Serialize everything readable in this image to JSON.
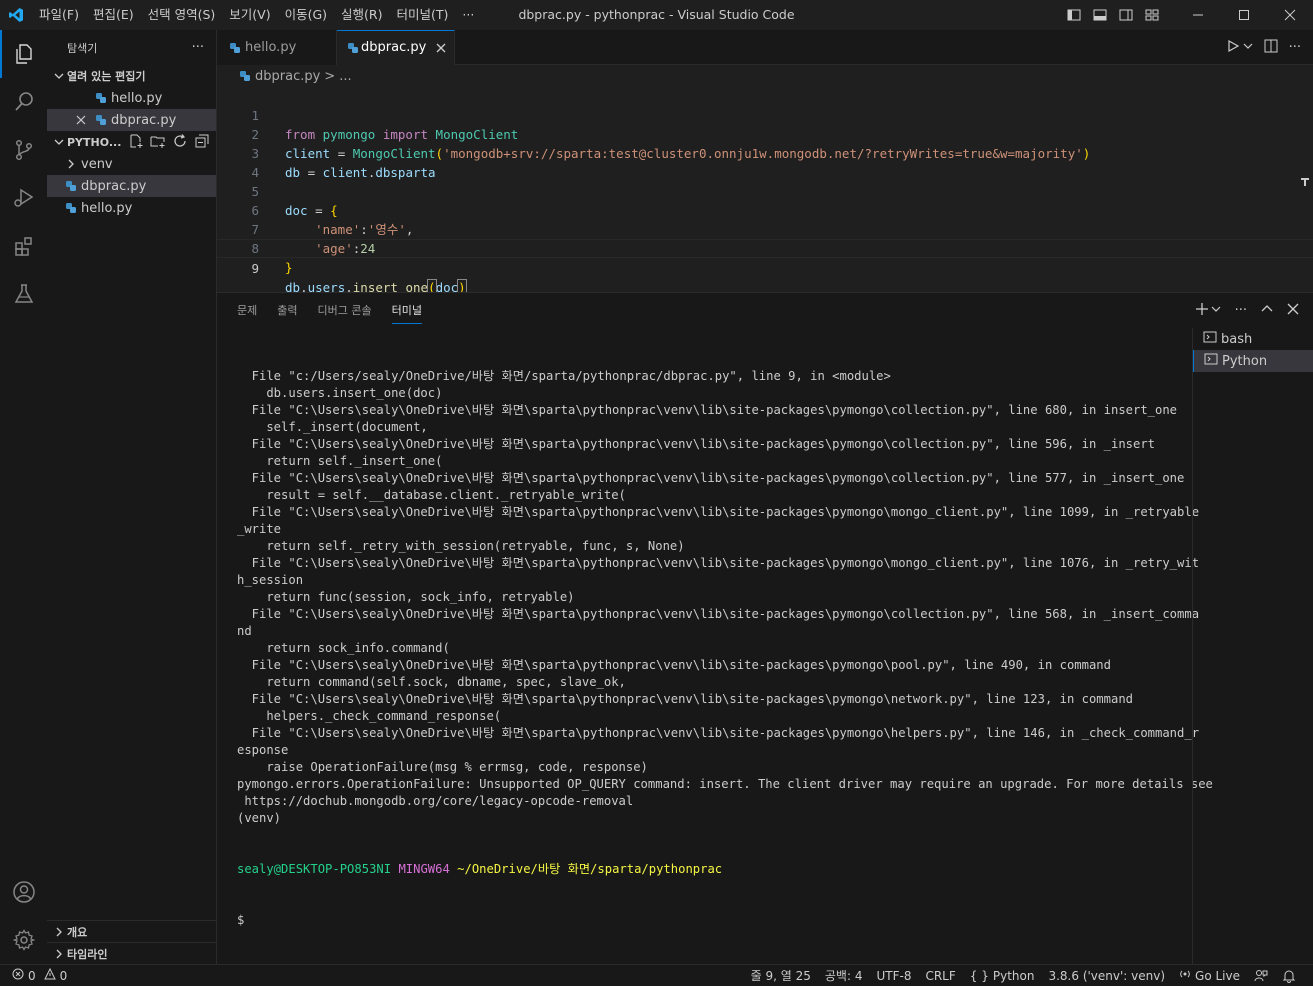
{
  "window": {
    "title": "dbprac.py - pythonprac - Visual Studio Code",
    "menu": [
      "파일(F)",
      "편집(E)",
      "선택 영역(S)",
      "보기(V)",
      "이동(G)",
      "실행(R)",
      "터미널(T)",
      "···"
    ]
  },
  "activity_bar": {
    "items": [
      "explorer-icon",
      "search-icon",
      "source-control-icon",
      "run-debug-icon",
      "extensions-icon",
      "testing-icon"
    ],
    "bottom": [
      "account-icon",
      "manage-gear-icon"
    ],
    "accent": "#0078d4"
  },
  "sidebar": {
    "title": "탐색기",
    "more": "···",
    "open_editors_label": "열려 있는 편집기",
    "open_editors": [
      {
        "label": "hello.py"
      },
      {
        "label": "dbprac.py"
      }
    ],
    "project_label": "PYTHO...",
    "tree": [
      {
        "label": "venv"
      },
      {
        "label": "dbprac.py"
      },
      {
        "label": "hello.py"
      }
    ],
    "outline_label": "개요",
    "timeline_label": "타임라인"
  },
  "tabs": [
    {
      "label": "hello.py"
    },
    {
      "label": "dbprac.py"
    }
  ],
  "breadcrumb": {
    "file": "dbprac.py",
    "sep": ">",
    "rest": "..."
  },
  "editor": {
    "line_numbers": [
      "1",
      "2",
      "3",
      "4",
      "5",
      "6",
      "7",
      "8",
      "9"
    ],
    "current_line": "9"
  },
  "panel": {
    "tabs": [
      "문제",
      "출력",
      "디버그 콘솔",
      "터미널"
    ],
    "active_tab": "터미널",
    "terminals": [
      "bash",
      "Python"
    ],
    "selected_terminal": "Python",
    "output": [
      "  File \"c:/Users/sealy/OneDrive/바탕 화면/sparta/pythonprac/dbprac.py\", line 9, in <module>",
      "    db.users.insert_one(doc)",
      "  File \"C:\\Users\\sealy\\OneDrive\\바탕 화면\\sparta\\pythonprac\\venv\\lib\\site-packages\\pymongo\\collection.py\", line 680, in insert_one",
      "    self._insert(document,",
      "  File \"C:\\Users\\sealy\\OneDrive\\바탕 화면\\sparta\\pythonprac\\venv\\lib\\site-packages\\pymongo\\collection.py\", line 596, in _insert",
      "    return self._insert_one(",
      "  File \"C:\\Users\\sealy\\OneDrive\\바탕 화면\\sparta\\pythonprac\\venv\\lib\\site-packages\\pymongo\\collection.py\", line 577, in _insert_one",
      "    result = self.__database.client._retryable_write(",
      "  File \"C:\\Users\\sealy\\OneDrive\\바탕 화면\\sparta\\pythonprac\\venv\\lib\\site-packages\\pymongo\\mongo_client.py\", line 1099, in _retryable",
      "_write",
      "    return self._retry_with_session(retryable, func, s, None)",
      "  File \"C:\\Users\\sealy\\OneDrive\\바탕 화면\\sparta\\pythonprac\\venv\\lib\\site-packages\\pymongo\\mongo_client.py\", line 1076, in _retry_wit",
      "h_session",
      "    return func(session, sock_info, retryable)",
      "  File \"C:\\Users\\sealy\\OneDrive\\바탕 화면\\sparta\\pythonprac\\venv\\lib\\site-packages\\pymongo\\collection.py\", line 568, in _insert_comma",
      "nd",
      "    return sock_info.command(",
      "  File \"C:\\Users\\sealy\\OneDrive\\바탕 화면\\sparta\\pythonprac\\venv\\lib\\site-packages\\pymongo\\pool.py\", line 490, in command",
      "    return command(self.sock, dbname, spec, slave_ok,",
      "  File \"C:\\Users\\sealy\\OneDrive\\바탕 화면\\sparta\\pythonprac\\venv\\lib\\site-packages\\pymongo\\network.py\", line 123, in command",
      "    helpers._check_command_response(",
      "  File \"C:\\Users\\sealy\\OneDrive\\바탕 화면\\sparta\\pythonprac\\venv\\lib\\site-packages\\pymongo\\helpers.py\", line 146, in _check_command_r",
      "esponse",
      "    raise OperationFailure(msg % errmsg, code, response)",
      "pymongo.errors.OperationFailure: Unsupported OP_QUERY command: insert. The client driver may require an upgrade. For more details see",
      " https://dochub.mongodb.org/core/legacy-opcode-removal",
      "(venv)"
    ],
    "prompt_user": "sealy@DESKTOP-PO853NI",
    "prompt_shell": "MINGW64",
    "prompt_path": "~/OneDrive/바탕 화면/sparta/pythonprac",
    "prompt_symbol": "$"
  },
  "statusbar": {
    "errors": "0",
    "warnings": "0",
    "position": "줄 9, 열 25",
    "spaces": "공백: 4",
    "encoding": "UTF-8",
    "eol": "CRLF",
    "language": "Python",
    "interpreter": "3.8.6 ('venv': venv)",
    "golive": "Go Live"
  },
  "colors": {
    "keyword": "#c586c0",
    "function": "#dcdcaa",
    "class": "#4ec9b0",
    "string": "#ce9178",
    "variable": "#9cdcfe",
    "number": "#b5cea8",
    "brace": "#ffd700",
    "python_icon": "#3e8ec6"
  }
}
